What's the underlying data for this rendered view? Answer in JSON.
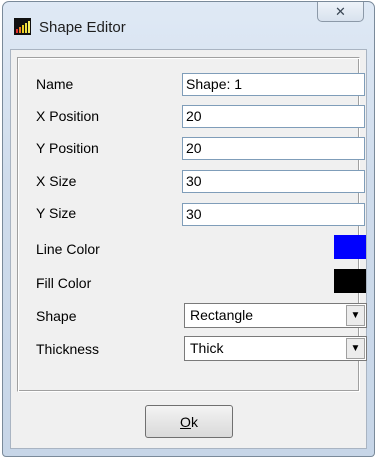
{
  "window": {
    "title": "Shape Editor",
    "close_glyph": "✕"
  },
  "form": {
    "name_label": "Name",
    "name_value": "Shape: 1",
    "x_position_label": "X Position",
    "x_position_value": "20",
    "y_position_label": "Y Position",
    "y_position_value": "20",
    "x_size_label": "X Size",
    "x_size_value": "30",
    "y_size_label": "Y Size",
    "y_size_value": "30",
    "line_color_label": "Line Color",
    "line_color": "#0000ff",
    "fill_color_label": "Fill Color",
    "fill_color": "#000000",
    "shape_label": "Shape",
    "shape_value": "Rectangle",
    "thickness_label": "Thickness",
    "thickness_value": "Thick"
  },
  "buttons": {
    "ok_mnemonic": "O",
    "ok_rest": "k"
  },
  "icons": {
    "app": "bar-chart-icon",
    "dropdown": "dropdown-arrow-icon"
  }
}
